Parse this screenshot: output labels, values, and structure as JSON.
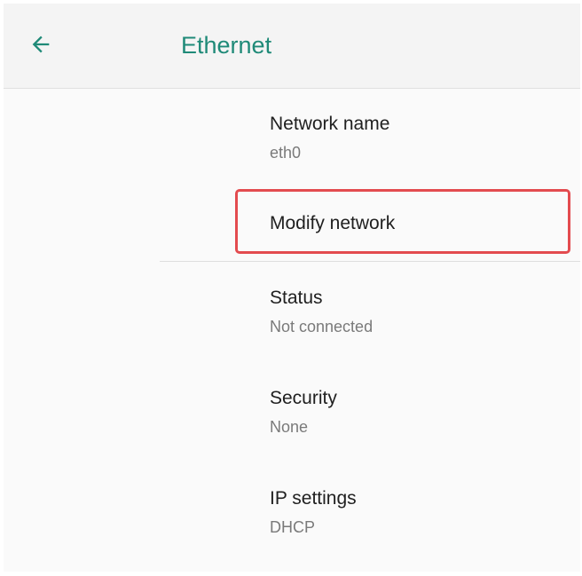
{
  "app_bar": {
    "back_icon": "arrow-left-icon",
    "title": "Ethernet"
  },
  "items": [
    {
      "title": "Network name",
      "subtitle": "eth0"
    },
    {
      "title": "Modify network"
    },
    {
      "title": "Status",
      "subtitle": "Not connected"
    },
    {
      "title": "Security",
      "subtitle": "None"
    },
    {
      "title": "IP settings",
      "subtitle": "DHCP"
    }
  ],
  "colors": {
    "accent": "#1f8a78",
    "highlight_border": "#e34b4f",
    "app_bar_bg": "#f4f4f4",
    "background": "#fafafa"
  }
}
